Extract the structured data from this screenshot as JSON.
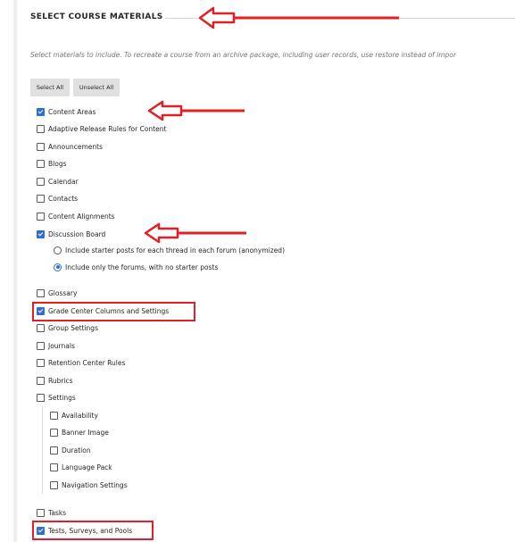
{
  "section": {
    "title": "SELECT COURSE MATERIALS",
    "instructions": "Select materials to include. To recreate a course from an archive package, including user records, use restore instead of impor"
  },
  "buttons": {
    "select_all": "Select All",
    "unselect_all": "Unselect All"
  },
  "materials": [
    {
      "label": "Content Areas",
      "checked": true
    },
    {
      "label": "Adaptive Release Rules for Content",
      "checked": false
    },
    {
      "label": "Announcements",
      "checked": false
    },
    {
      "label": "Blogs",
      "checked": false
    },
    {
      "label": "Calendar",
      "checked": false
    },
    {
      "label": "Contacts",
      "checked": false
    },
    {
      "label": "Content Alignments",
      "checked": false
    },
    {
      "label": "Discussion Board",
      "checked": true
    },
    {
      "label": "Glossary",
      "checked": false
    },
    {
      "label": "Grade Center Columns and Settings",
      "checked": true
    },
    {
      "label": "Group Settings",
      "checked": false
    },
    {
      "label": "Journals",
      "checked": false
    },
    {
      "label": "Retention Center Rules",
      "checked": false
    },
    {
      "label": "Rubrics",
      "checked": false
    },
    {
      "label": "Settings",
      "checked": false
    },
    {
      "label": "Tasks",
      "checked": false
    },
    {
      "label": "Tests, Surveys, and Pools",
      "checked": true
    }
  ],
  "discussion_options": [
    {
      "label": "Include starter posts for each thread in each forum (anonymized)",
      "selected": false
    },
    {
      "label": "Include only the forums, with no starter posts",
      "selected": true
    }
  ],
  "settings_children": [
    {
      "label": "Availability",
      "checked": false
    },
    {
      "label": "Banner Image",
      "checked": false
    },
    {
      "label": "Duration",
      "checked": false
    },
    {
      "label": "Language Pack",
      "checked": false
    },
    {
      "label": "Navigation Settings",
      "checked": false
    }
  ],
  "annotation_color": "#e01f26"
}
